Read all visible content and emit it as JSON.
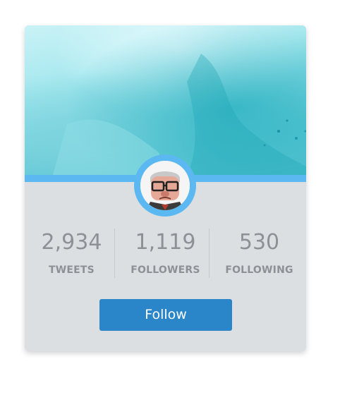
{
  "profile_card": {
    "stats": [
      {
        "value": "2,934",
        "label": "TWEETS"
      },
      {
        "value": "1,119",
        "label": "FOLLOWERS"
      },
      {
        "value": "530",
        "label": "FOLLOWING"
      }
    ],
    "follow_label": "Follow"
  },
  "colors": {
    "accent": "#5bb8f0",
    "button": "#2a86c9",
    "card_background": "#dcdfe2",
    "stat_text": "#8c9196"
  }
}
